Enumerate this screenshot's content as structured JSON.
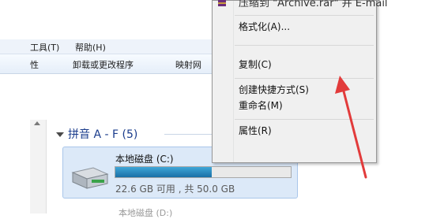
{
  "menubar": {
    "tools": "工具(T)",
    "help": "帮助(H)"
  },
  "toolbar": {
    "properties": "性",
    "uninstall": "卸载或更改程序",
    "map": "映射网"
  },
  "group": {
    "header": "拼音 A - F (5)"
  },
  "drive": {
    "label": "本地磁盘 (C:)",
    "size_text": "22.6 GB 可用 , 共 50.0 GB",
    "free_gb": 22.6,
    "total_gb": 50.0
  },
  "next_drive_text": "本地磁盘 (D:)",
  "context_menu": {
    "top_partial": "压缩到 \"Archive.rar\" 并 E-mail",
    "format": "格式化(A)...",
    "copy": "复制(C)",
    "create_shortcut": "创建快捷方式(S)",
    "rename": "重命名(M)",
    "properties": "属性(R)"
  },
  "colors": {
    "annotation_arrow": "#e23b3b",
    "bar_fill": "#1a6fa6"
  },
  "icons": [
    "hard-drive-icon",
    "winrar-icon",
    "arrow-annotation"
  ]
}
